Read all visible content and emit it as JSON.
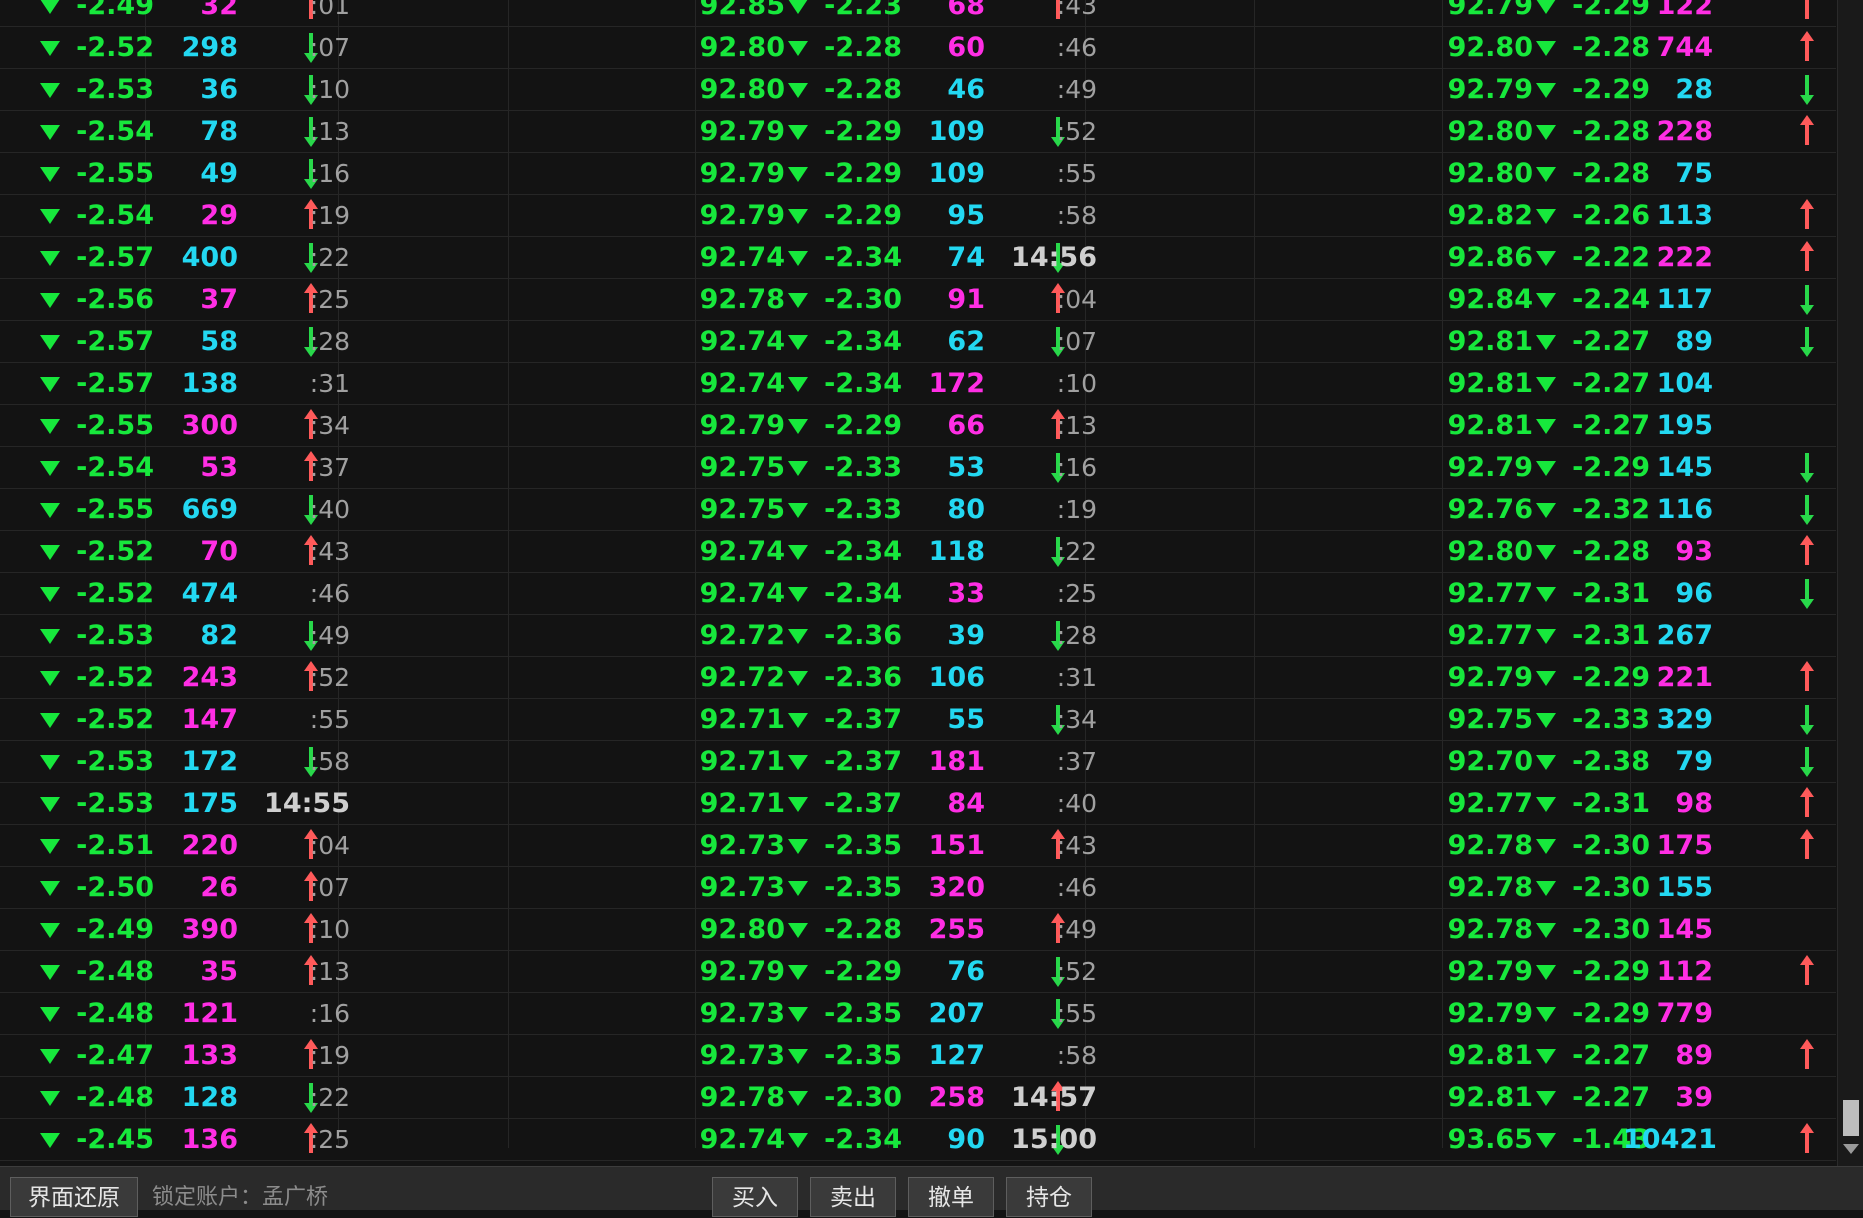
{
  "rows": [
    {
      "c1": "-2.49",
      "v1": "32",
      "d1": "up",
      "t1": ":01",
      "p1": "92.85",
      "c2": "-2.23",
      "v2": "68",
      "d2": "up",
      "t2": ":43",
      "p2": "92.79",
      "c3": "-2.29",
      "v3": "122",
      "d3": "up"
    },
    {
      "c1": "-2.52",
      "v1": "298",
      "d1": "down",
      "t1": ":07",
      "p1": "92.80",
      "c2": "-2.28",
      "v2": "60",
      "d2": "",
      "t2": ":46",
      "p2": "92.80",
      "c3": "-2.28",
      "v3": "744",
      "d3": "up"
    },
    {
      "c1": "-2.53",
      "v1": "36",
      "d1": "down",
      "t1": ":10",
      "p1": "92.80",
      "c2": "-2.28",
      "v2": "46",
      "d2": "",
      "t2": ":49",
      "p2": "92.79",
      "c3": "-2.29",
      "v3": "28",
      "d3": "down"
    },
    {
      "c1": "-2.54",
      "v1": "78",
      "d1": "down",
      "t1": ":13",
      "p1": "92.79",
      "c2": "-2.29",
      "v2": "109",
      "d2": "down",
      "t2": ":52",
      "p2": "92.80",
      "c3": "-2.28",
      "v3": "228",
      "d3": "up"
    },
    {
      "c1": "-2.55",
      "v1": "49",
      "d1": "down",
      "t1": ":16",
      "p1": "92.79",
      "c2": "-2.29",
      "v2": "109",
      "d2": "",
      "t2": ":55",
      "p2": "92.80",
      "c3": "-2.28",
      "v3": "75",
      "d3": ""
    },
    {
      "c1": "-2.54",
      "v1": "29",
      "d1": "up",
      "t1": ":19",
      "p1": "92.79",
      "c2": "-2.29",
      "v2": "95",
      "d2": "",
      "t2": ":58",
      "p2": "92.82",
      "c3": "-2.26",
      "v3": "113",
      "d3": "up"
    },
    {
      "c1": "-2.57",
      "v1": "400",
      "d1": "down",
      "t1": ":22",
      "p1": "92.74",
      "c2": "-2.34",
      "v2": "74",
      "d2": "down",
      "t2": "14:56",
      "p2": "92.86",
      "c3": "-2.22",
      "v3": "222",
      "d3": "up"
    },
    {
      "c1": "-2.56",
      "v1": "37",
      "d1": "up",
      "t1": ":25",
      "p1": "92.78",
      "c2": "-2.30",
      "v2": "91",
      "d2": "up",
      "t2": ":04",
      "p2": "92.84",
      "c3": "-2.24",
      "v3": "117",
      "d3": "down"
    },
    {
      "c1": "-2.57",
      "v1": "58",
      "d1": "down",
      "t1": ":28",
      "p1": "92.74",
      "c2": "-2.34",
      "v2": "62",
      "d2": "down",
      "t2": ":07",
      "p2": "92.81",
      "c3": "-2.27",
      "v3": "89",
      "d3": "down"
    },
    {
      "c1": "-2.57",
      "v1": "138",
      "d1": "",
      "t1": ":31",
      "p1": "92.74",
      "c2": "-2.34",
      "v2": "172",
      "d2": "",
      "t2": ":10",
      "p2": "92.81",
      "c3": "-2.27",
      "v3": "104",
      "d3": ""
    },
    {
      "c1": "-2.55",
      "v1": "300",
      "d1": "up",
      "t1": ":34",
      "p1": "92.79",
      "c2": "-2.29",
      "v2": "66",
      "d2": "up",
      "t2": ":13",
      "p2": "92.81",
      "c3": "-2.27",
      "v3": "195",
      "d3": ""
    },
    {
      "c1": "-2.54",
      "v1": "53",
      "d1": "up",
      "t1": ":37",
      "p1": "92.75",
      "c2": "-2.33",
      "v2": "53",
      "d2": "down",
      "t2": ":16",
      "p2": "92.79",
      "c3": "-2.29",
      "v3": "145",
      "d3": "down"
    },
    {
      "c1": "-2.55",
      "v1": "669",
      "d1": "down",
      "t1": ":40",
      "p1": "92.75",
      "c2": "-2.33",
      "v2": "80",
      "d2": "",
      "t2": ":19",
      "p2": "92.76",
      "c3": "-2.32",
      "v3": "116",
      "d3": "down"
    },
    {
      "c1": "-2.52",
      "v1": "70",
      "d1": "up",
      "t1": ":43",
      "p1": "92.74",
      "c2": "-2.34",
      "v2": "118",
      "d2": "down",
      "t2": ":22",
      "p2": "92.80",
      "c3": "-2.28",
      "v3": "93",
      "d3": "up"
    },
    {
      "c1": "-2.52",
      "v1": "474",
      "d1": "",
      "t1": ":46",
      "p1": "92.74",
      "c2": "-2.34",
      "v2": "33",
      "d2": "",
      "t2": ":25",
      "p2": "92.77",
      "c3": "-2.31",
      "v3": "96",
      "d3": "down"
    },
    {
      "c1": "-2.53",
      "v1": "82",
      "d1": "down",
      "t1": ":49",
      "p1": "92.72",
      "c2": "-2.36",
      "v2": "39",
      "d2": "down",
      "t2": ":28",
      "p2": "92.77",
      "c3": "-2.31",
      "v3": "267",
      "d3": ""
    },
    {
      "c1": "-2.52",
      "v1": "243",
      "d1": "up",
      "t1": ":52",
      "p1": "92.72",
      "c2": "-2.36",
      "v2": "106",
      "d2": "",
      "t2": ":31",
      "p2": "92.79",
      "c3": "-2.29",
      "v3": "221",
      "d3": "up"
    },
    {
      "c1": "-2.52",
      "v1": "147",
      "d1": "",
      "t1": ":55",
      "p1": "92.71",
      "c2": "-2.37",
      "v2": "55",
      "d2": "down",
      "t2": ":34",
      "p2": "92.75",
      "c3": "-2.33",
      "v3": "329",
      "d3": "down"
    },
    {
      "c1": "-2.53",
      "v1": "172",
      "d1": "down",
      "t1": ":58",
      "p1": "92.71",
      "c2": "-2.37",
      "v2": "181",
      "d2": "",
      "t2": ":37",
      "p2": "92.70",
      "c3": "-2.38",
      "v3": "79",
      "d3": "down"
    },
    {
      "c1": "-2.53",
      "v1": "175",
      "d1": "",
      "t1": "14:55",
      "p1": "92.71",
      "c2": "-2.37",
      "v2": "84",
      "d2": "",
      "t2": ":40",
      "p2": "92.77",
      "c3": "-2.31",
      "v3": "98",
      "d3": "up"
    },
    {
      "c1": "-2.51",
      "v1": "220",
      "d1": "up",
      "t1": ":04",
      "p1": "92.73",
      "c2": "-2.35",
      "v2": "151",
      "d2": "up",
      "t2": ":43",
      "p2": "92.78",
      "c3": "-2.30",
      "v3": "175",
      "d3": "up"
    },
    {
      "c1": "-2.50",
      "v1": "26",
      "d1": "up",
      "t1": ":07",
      "p1": "92.73",
      "c2": "-2.35",
      "v2": "320",
      "d2": "",
      "t2": ":46",
      "p2": "92.78",
      "c3": "-2.30",
      "v3": "155",
      "d3": ""
    },
    {
      "c1": "-2.49",
      "v1": "390",
      "d1": "up",
      "t1": ":10",
      "p1": "92.80",
      "c2": "-2.28",
      "v2": "255",
      "d2": "up",
      "t2": ":49",
      "p2": "92.78",
      "c3": "-2.30",
      "v3": "145",
      "d3": ""
    },
    {
      "c1": "-2.48",
      "v1": "35",
      "d1": "up",
      "t1": ":13",
      "p1": "92.79",
      "c2": "-2.29",
      "v2": "76",
      "d2": "down",
      "t2": ":52",
      "p2": "92.79",
      "c3": "-2.29",
      "v3": "112",
      "d3": "up"
    },
    {
      "c1": "-2.48",
      "v1": "121",
      "d1": "",
      "t1": ":16",
      "p1": "92.73",
      "c2": "-2.35",
      "v2": "207",
      "d2": "down",
      "t2": ":55",
      "p2": "92.79",
      "c3": "-2.29",
      "v3": "779",
      "d3": ""
    },
    {
      "c1": "-2.47",
      "v1": "133",
      "d1": "up",
      "t1": ":19",
      "p1": "92.73",
      "c2": "-2.35",
      "v2": "127",
      "d2": "",
      "t2": ":58",
      "p2": "92.81",
      "c3": "-2.27",
      "v3": "89",
      "d3": "up"
    },
    {
      "c1": "-2.48",
      "v1": "128",
      "d1": "down",
      "t1": ":22",
      "p1": "92.78",
      "c2": "-2.30",
      "v2": "258",
      "d2": "up",
      "t2": "14:57",
      "p2": "92.81",
      "c3": "-2.27",
      "v3": "39",
      "d3": ""
    },
    {
      "c1": "-2.45",
      "v1": "136",
      "d1": "up",
      "t1": ":25",
      "p1": "92.74",
      "c2": "-2.34",
      "v2": "90",
      "d2": "down",
      "t2": "15:00",
      "p2": "93.65",
      "c3": "-1.43",
      "v3": "10421",
      "d3": "up"
    }
  ],
  "vol_color": {
    "up": "#ff2ee4",
    "down": "#23d8f2",
    "none_up": "#ff2ee4",
    "none_down": "#23d8f2"
  },
  "vol_kind": [
    "u",
    "d",
    "d",
    "d",
    "d",
    "u",
    "d",
    "u",
    "d",
    "d",
    "u",
    "u",
    "d",
    "u",
    "d",
    "d",
    "u",
    "u",
    "d",
    "d",
    "u",
    "u",
    "u",
    "u",
    "u",
    "u",
    "d",
    "u"
  ],
  "vol_kind2": [
    "u",
    "u",
    "d",
    "d",
    "d",
    "d",
    "d",
    "u",
    "d",
    "u",
    "u",
    "d",
    "d",
    "d",
    "u",
    "d",
    "d",
    "d",
    "u",
    "u",
    "u",
    "u",
    "u",
    "d",
    "d",
    "d",
    "u",
    "d"
  ],
  "vol_kind3": [
    "u",
    "u",
    "d",
    "u",
    "d",
    "d",
    "u",
    "d",
    "d",
    "d",
    "d",
    "d",
    "d",
    "u",
    "d",
    "d",
    "u",
    "d",
    "d",
    "u",
    "u",
    "d",
    "u",
    "u",
    "u",
    "u",
    "u",
    "d"
  ],
  "arrow_colors": {
    "up": "#ff5a5a",
    "down": "#28d84a"
  },
  "bottom_bar": {
    "restore_label": "界面还原",
    "account_label": "锁定账户：孟广桥",
    "buy_label": "买入",
    "sell_label": "卖出",
    "cancel_label": "撤单",
    "position_label": "持仓"
  }
}
